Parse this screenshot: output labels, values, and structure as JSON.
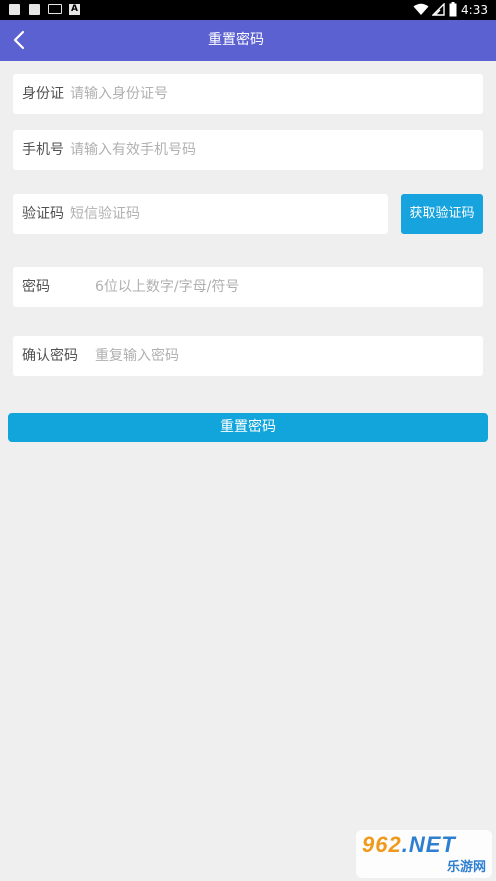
{
  "status_bar": {
    "time": "4:33",
    "icons": [
      "notification-square-icon",
      "notification-square-icon",
      "keyboard-icon",
      "a-notification-icon",
      "wifi-icon",
      "signal-icon",
      "battery-icon"
    ]
  },
  "header": {
    "title": "重置密码",
    "back_icon": "chevron-left-icon",
    "background": "#5c61d2"
  },
  "form": {
    "id_card": {
      "label": "身份证",
      "placeholder": "请输入身份证号",
      "value": ""
    },
    "phone": {
      "label": "手机号",
      "placeholder": "请输入有效手机号码",
      "value": ""
    },
    "sms_code": {
      "label": "验证码",
      "placeholder": "短信验证码",
      "value": "",
      "button_label": "获取验证码"
    },
    "password": {
      "label": "密码",
      "placeholder": "6位以上数字/字母/符号",
      "value": ""
    },
    "confirm_password": {
      "label": "确认密码",
      "placeholder": "重复输入密码",
      "value": ""
    }
  },
  "submit": {
    "label": "重置密码",
    "color": "#11a5dc"
  },
  "watermark": {
    "brand": "962",
    "suffix": ".NET",
    "site": "乐游网"
  }
}
